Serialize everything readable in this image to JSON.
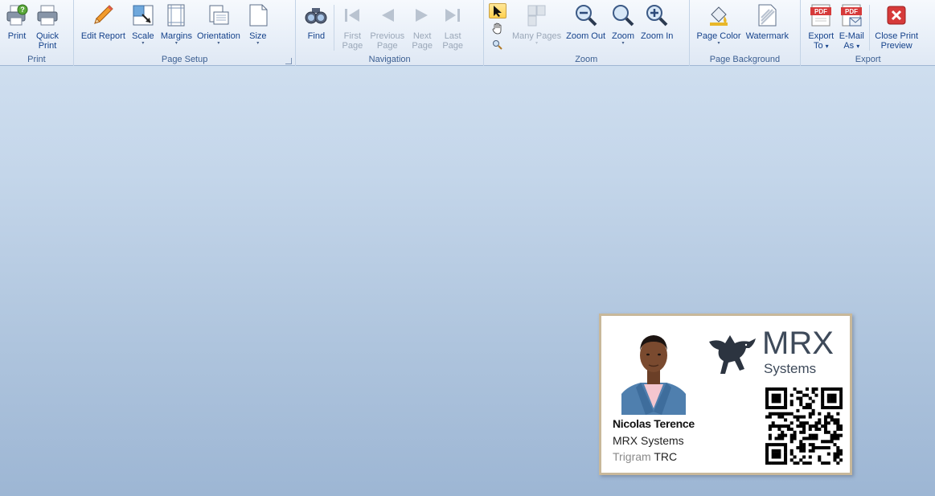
{
  "ribbon": {
    "groups": {
      "print": {
        "label": "Print",
        "print": "Print",
        "quick_print_1": "Quick",
        "quick_print_2": "Print"
      },
      "page_setup": {
        "label": "Page Setup",
        "edit_report": "Edit Report",
        "scale": "Scale",
        "margins": "Margins",
        "orientation": "Orientation",
        "size": "Size"
      },
      "navigation": {
        "label": "Navigation",
        "find": "Find",
        "first_1": "First",
        "first_2": "Page",
        "prev_1": "Previous",
        "prev_2": "Page",
        "next_1": "Next",
        "next_2": "Page",
        "last_1": "Last",
        "last_2": "Page"
      },
      "zoom": {
        "label": "Zoom",
        "many_pages": "Many Pages",
        "zoom_out": "Zoom Out",
        "zoom": "Zoom",
        "zoom_in": "Zoom In"
      },
      "page_background": {
        "label": "Page Background",
        "page_color": "Page Color",
        "watermark": "Watermark"
      },
      "export": {
        "label": "Export",
        "export_1": "Export",
        "export_2": "To",
        "email_1": "E-Mail",
        "email_2": "As",
        "close_1": "Close Print",
        "close_2": "Preview"
      }
    },
    "pdf_icon_text": "PDF",
    "dropdown_glyph": "▾"
  },
  "badge": {
    "name": "Nicolas Terence",
    "company": "MRX Systems",
    "trigram_label": "Trigram",
    "trigram_value": "TRC",
    "logo_main": "MRX",
    "logo_sub": "Systems"
  },
  "colors": {
    "ribbon_text": "#15428b",
    "disabled_text": "#9aa7b8",
    "badge_border": "#c8b89a",
    "logo": "#3e4a5a",
    "close_red": "#d63a3a"
  }
}
